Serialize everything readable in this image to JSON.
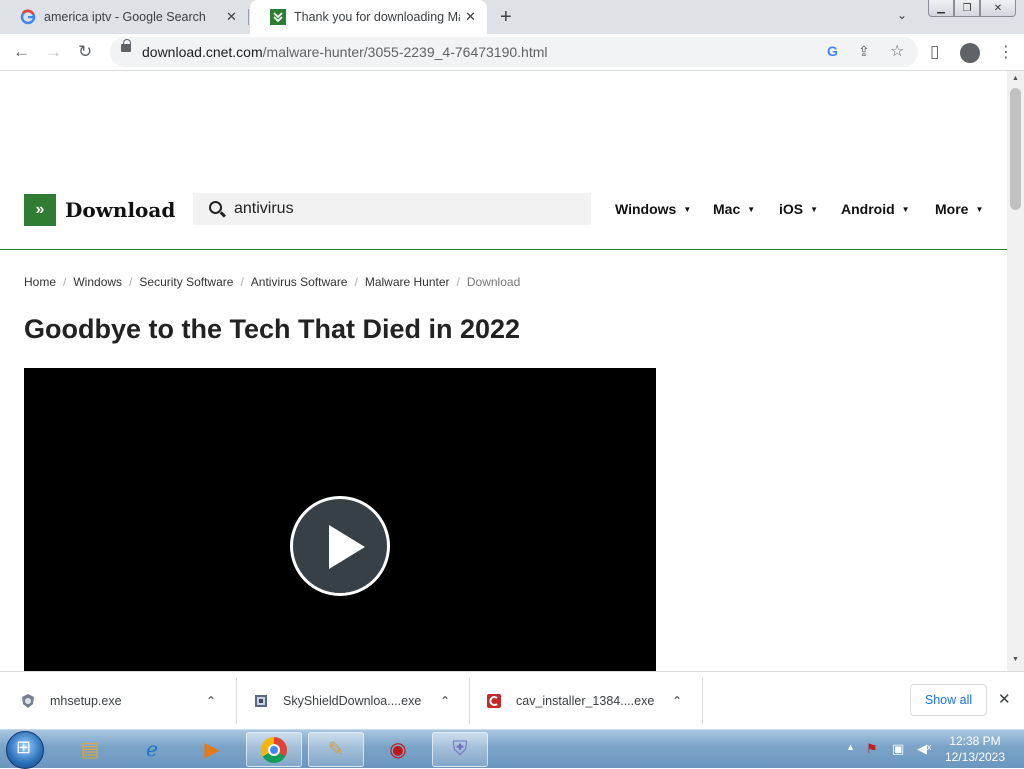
{
  "browser": {
    "tabs": [
      {
        "title": "america iptv - Google Search",
        "favicon": "google-icon"
      },
      {
        "title": "Thank you for downloading Malware Hunter",
        "favicon": "cnet-download-icon",
        "active": true
      }
    ],
    "new_tab": "+",
    "url_host": "download.cnet.com",
    "url_path": "/malware-hunter/3055-2239_4-76473190.html"
  },
  "site": {
    "logo_text": "Download",
    "search_value": "antivirus",
    "nav": [
      "Windows",
      "Mac",
      "iOS",
      "Android",
      "More"
    ],
    "breadcrumb": [
      "Home",
      "Windows",
      "Security Software",
      "Antivirus Software",
      "Malware Hunter",
      "Download"
    ],
    "page_title": "Goodbye to the Tech That Died in 2022"
  },
  "downloads": {
    "items": [
      {
        "name": "mhsetup.exe",
        "icon": "malware-hunter-icon"
      },
      {
        "name": "SkyShieldDownloa....exe",
        "icon": "skyshield-icon"
      },
      {
        "name": "cav_installer_1384....exe",
        "icon": "comodo-icon"
      }
    ],
    "show_all": "Show all"
  },
  "taskbar": {
    "time": "12:38 PM",
    "date": "12/13/2023"
  },
  "colors": {
    "brand_green": "#2e7d32",
    "link_blue": "#1a73e8"
  }
}
